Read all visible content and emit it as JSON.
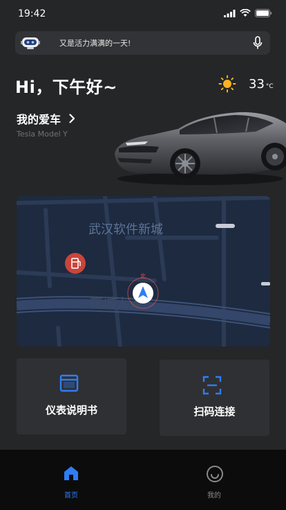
{
  "status_bar": {
    "time": "19:42"
  },
  "search": {
    "text": "又是活力满满的一天!"
  },
  "header": {
    "greeting": "Hi，下午好~",
    "temperature": "33",
    "temperature_unit": "°C"
  },
  "car": {
    "title": "我的爱车",
    "model": "Tesla Model Y"
  },
  "map": {
    "district_label": "武汉软件新城",
    "road_label": "花城大道",
    "compass_label": "北"
  },
  "cards": {
    "manual_label": "仪表说明书",
    "scan_label": "扫码连接"
  },
  "tabbar": {
    "home_label": "首页",
    "mine_label": "我的"
  },
  "colors": {
    "background": "#252628",
    "accent": "#2f7df6",
    "tabbar": "#0c0c0d",
    "card": "#2f3034"
  }
}
